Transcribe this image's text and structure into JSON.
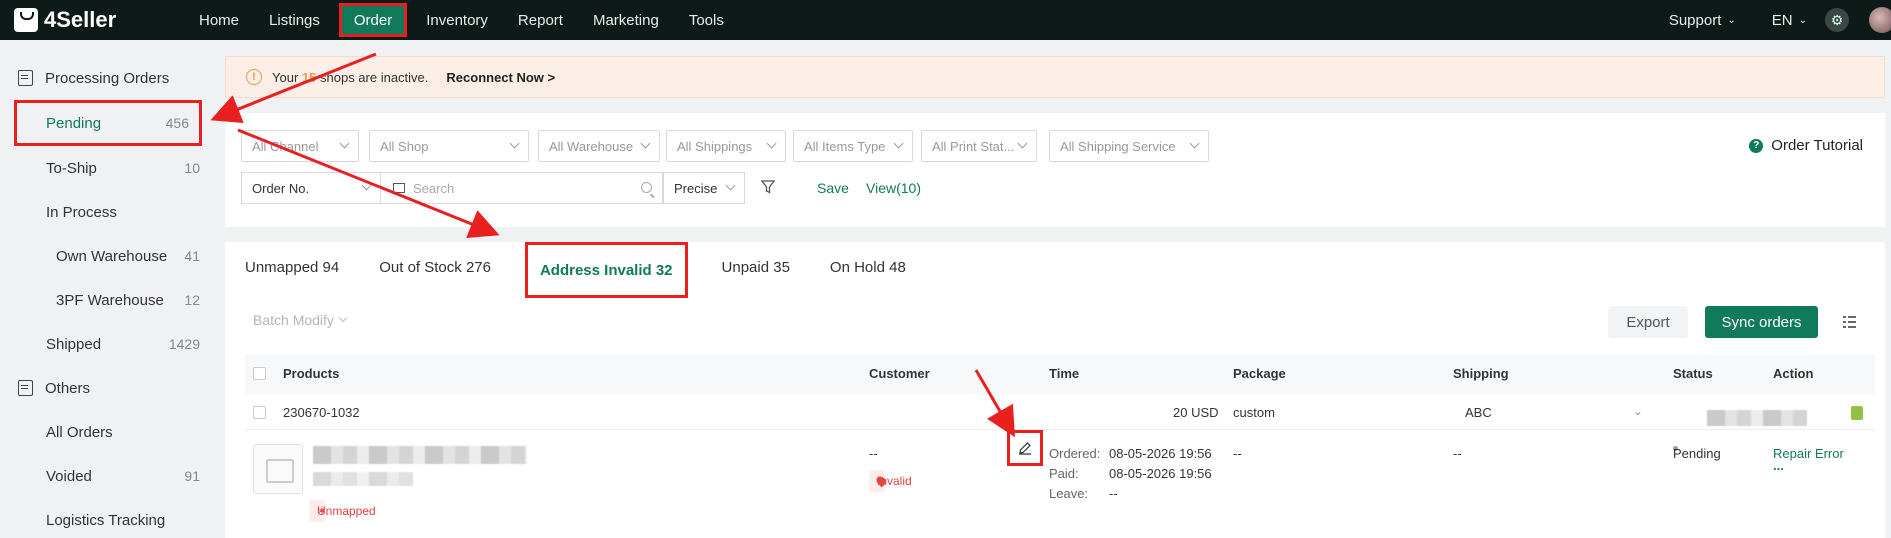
{
  "brand": "4Seller",
  "nav": {
    "items": [
      "Home",
      "Listings",
      "Order",
      "Inventory",
      "Report",
      "Marketing",
      "Tools"
    ],
    "support": "Support",
    "lang": "EN"
  },
  "sidebar": {
    "groups": [
      {
        "label": "Processing Orders"
      },
      {
        "label": "Others"
      }
    ],
    "processing": [
      {
        "label": "Pending",
        "count": "456"
      },
      {
        "label": "To-Ship",
        "count": "10"
      },
      {
        "label": "In Process",
        "count": ""
      },
      {
        "label": "Own Warehouse",
        "count": "41"
      },
      {
        "label": "3PF Warehouse",
        "count": "12"
      },
      {
        "label": "Shipped",
        "count": "1429"
      }
    ],
    "others": [
      {
        "label": "All Orders",
        "count": ""
      },
      {
        "label": "Voided",
        "count": "91"
      },
      {
        "label": "Logistics Tracking",
        "count": ""
      }
    ]
  },
  "banner": {
    "prefix": "Your",
    "count": "15",
    "suffix": "shops are inactive.",
    "action": "Reconnect Now >"
  },
  "filters": {
    "selects": [
      "All Channel",
      "All Shop",
      "All Warehouse",
      "All Shippings",
      "All Items Type",
      "All Print Stat...",
      "All Shipping Service"
    ],
    "order_no": "Order No.",
    "search_placeholder": "Search",
    "precise": "Precise",
    "save": "Save",
    "view": "View(10)",
    "tutorial": "Order Tutorial"
  },
  "tabs": [
    "Unmapped 94",
    "Out of Stock 276",
    "Address Invalid 32",
    "Unpaid 35",
    "On Hold 48"
  ],
  "toolbar": {
    "batch": "Batch Modify",
    "export": "Export",
    "sync": "Sync orders"
  },
  "table": {
    "headers": [
      "Products",
      "Customer",
      "Time",
      "Package",
      "Shipping",
      "Status",
      "Action"
    ],
    "summary": {
      "order_id": "230670-1032",
      "amount": "20 USD",
      "package": "custom",
      "shipping": "ABC"
    },
    "detail": {
      "unmapped_badge": "Unmapped",
      "customer": "--",
      "invalid_badge": "Invalid",
      "ordered_label": "Ordered:",
      "ordered_value": "08-05-2026 19:56",
      "paid_label": "Paid:",
      "paid_value": "08-05-2026 19:56",
      "leave_label": "Leave:",
      "leave_value": "--",
      "package": "--",
      "shipping": "--",
      "status": "Pending",
      "action": "Repair Error",
      "more": "..."
    }
  },
  "colors": {
    "brand_green": "#107a5a",
    "annotation_red": "#e82020",
    "topbar": "#0d1a17"
  }
}
